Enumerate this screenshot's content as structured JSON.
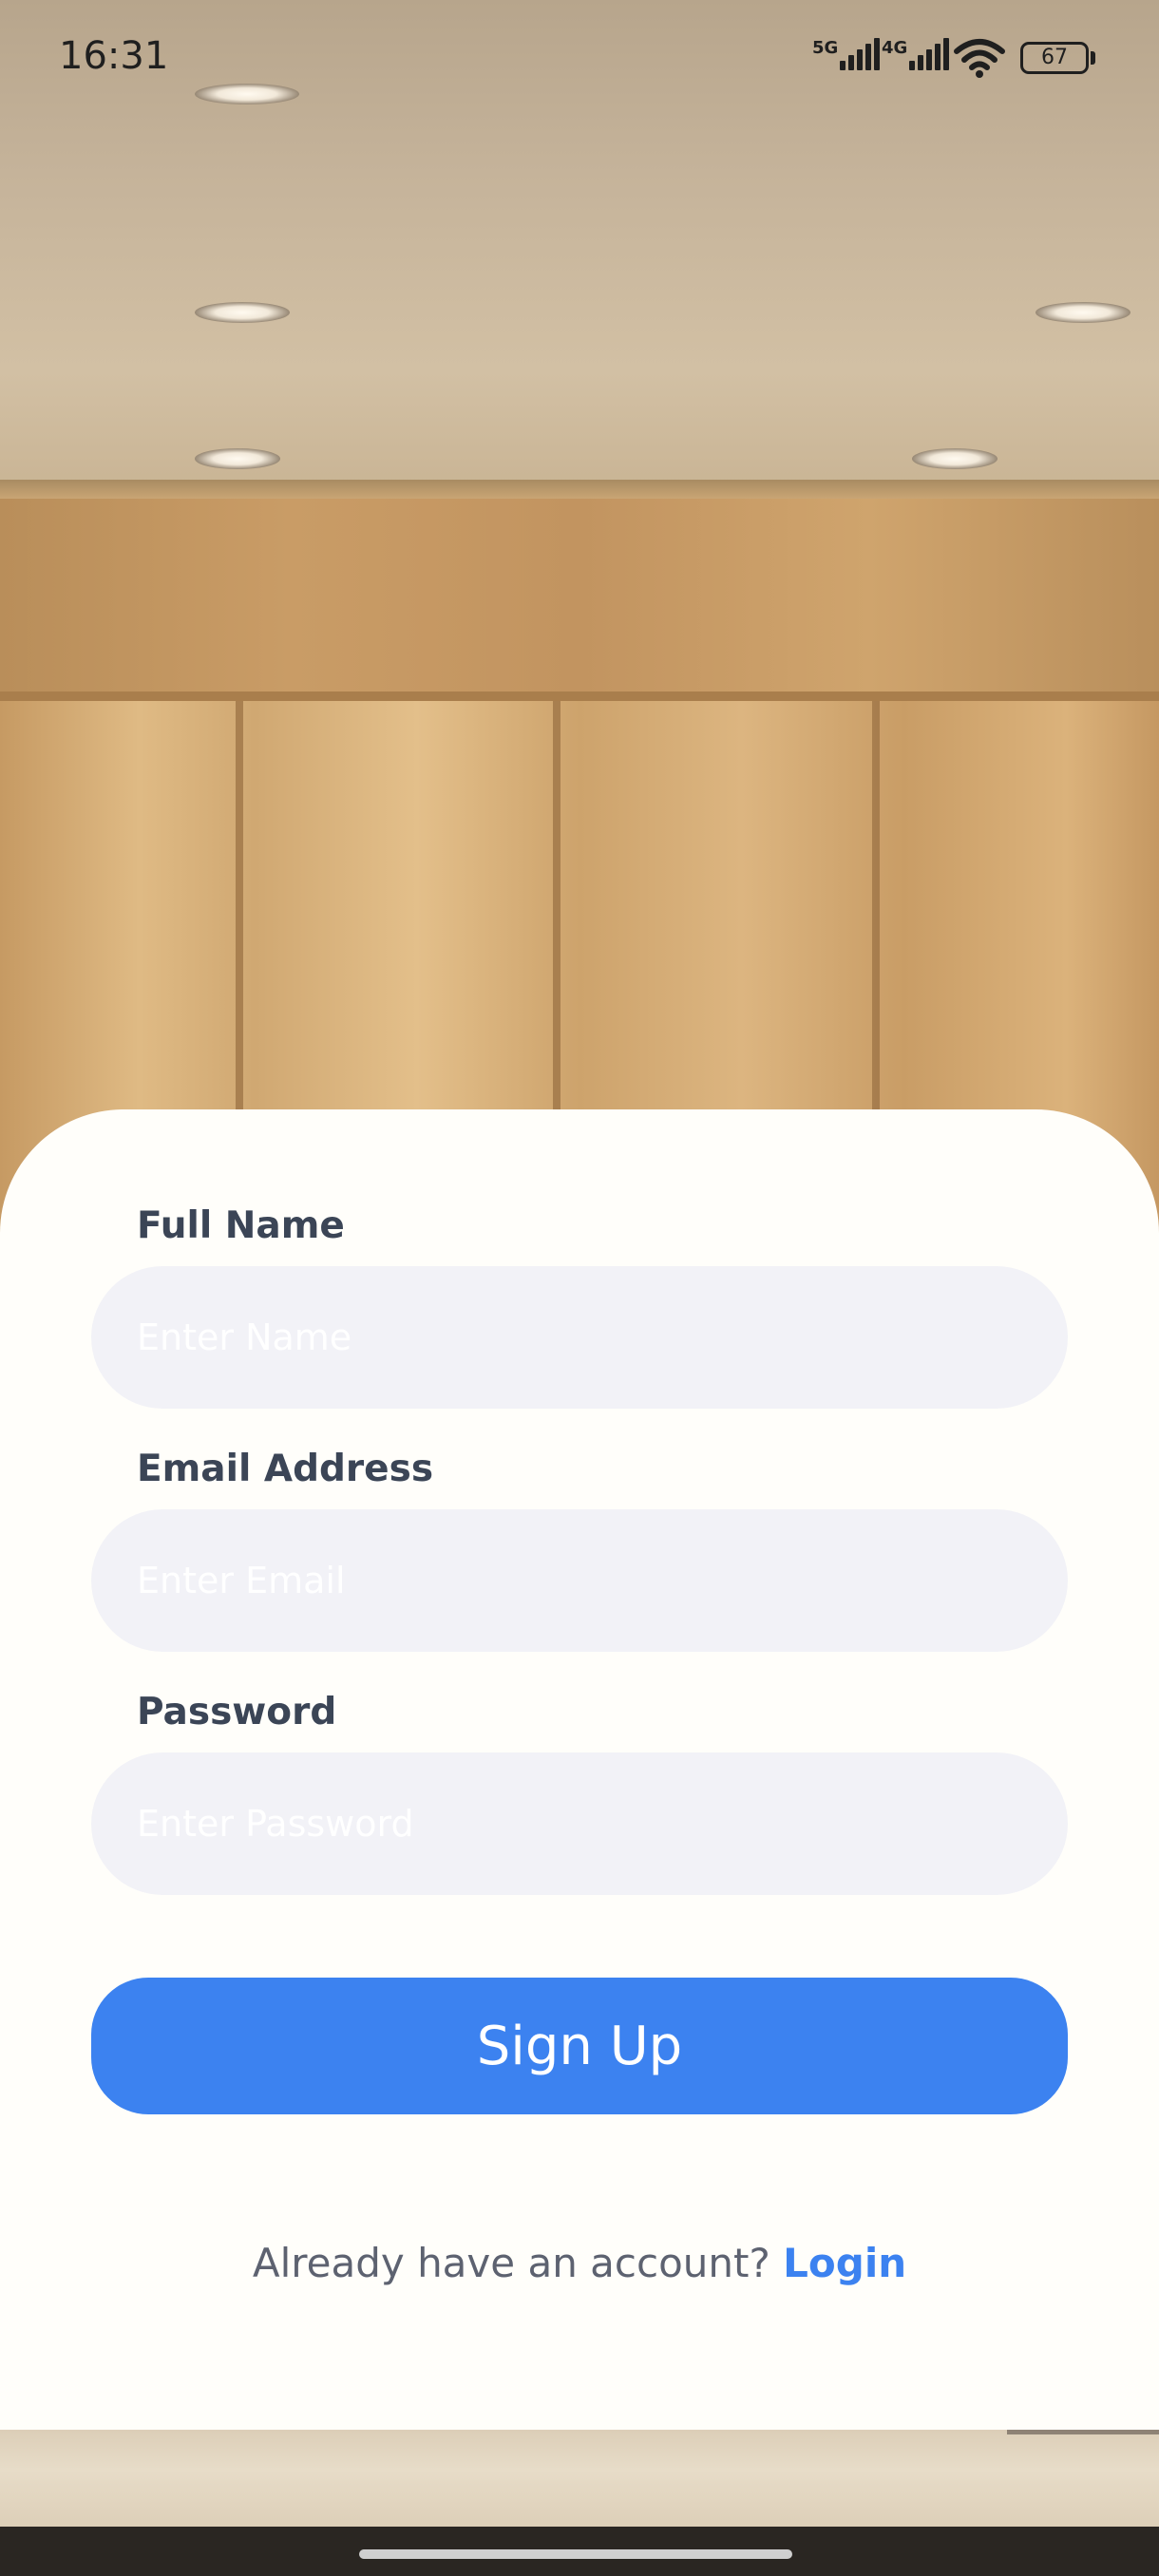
{
  "status_bar": {
    "time": "16:31",
    "network_1": "5G",
    "network_2": "4G",
    "battery": "67"
  },
  "form": {
    "full_name": {
      "label": "Full Name",
      "placeholder": "Enter Name"
    },
    "email": {
      "label": "Email Address",
      "placeholder": "Enter Email"
    },
    "password": {
      "label": "Password",
      "placeholder": "Enter Password"
    },
    "submit_label": "Sign Up"
  },
  "footer": {
    "prompt": "Already have an account? ",
    "login_label": "Login"
  },
  "colors": {
    "accent": "#3c82f0",
    "card_background": "#fffefa",
    "input_background": "#f2f2f7",
    "label_text": "#3b4556"
  }
}
